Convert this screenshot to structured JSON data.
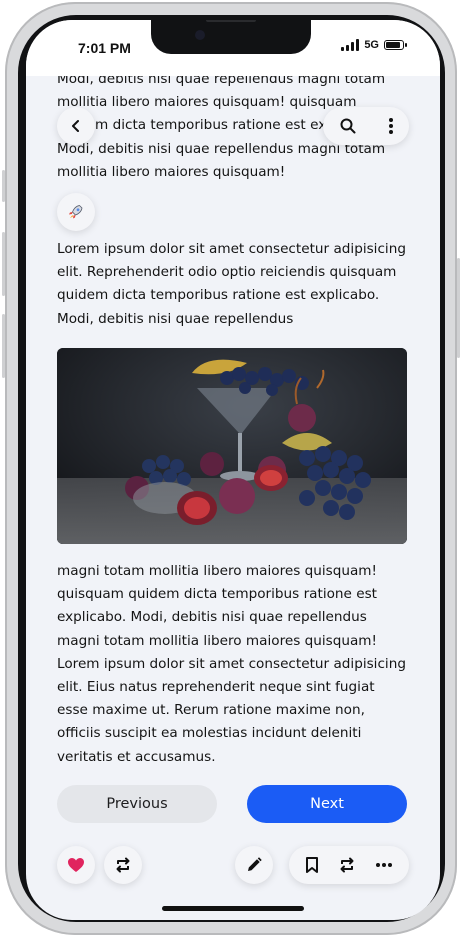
{
  "status_bar": {
    "time": "7:01 PM",
    "network": "5G"
  },
  "article": {
    "para_top": "Modi, debitis nisi quae repellendus magni totam mollitia libero maiores quisquam! quisquam quidem dicta temporibus ratione est explicabo. Modi, debitis nisi quae repellendus magni totam mollitia libero maiores quisquam!",
    "para_middle": "Lorem ipsum dolor sit amet consectetur adipisicing elit. Reprehenderit odio optio reiciendis quisquam quidem dicta temporibus ratione est explicabo. Modi, debitis nisi quae repellendus",
    "para_bottom": "magni totam mollitia libero maiores quisquam! quisquam quidem dicta temporibus ratione est explicabo. Modi, debitis nisi quae repellendus magni totam mollitia libero maiores quisquam! Lorem ipsum dolor sit amet consectetur adipisicing elit. Eius natus reprehenderit neque sint fugiat esse maxime ut. Rerum ratione maxime non, officiis suscipit ea molestias incidunt deleniti veritatis et accusamus."
  },
  "pagination": {
    "previous_label": "Previous",
    "next_label": "Next"
  },
  "icons": {
    "back": "chevron-left-icon",
    "search": "search-icon",
    "more_vertical": "more-vertical-icon",
    "rocket": "rocket-icon",
    "like": "heart-icon",
    "repost": "repost-icon",
    "edit": "pencil-icon",
    "bookmark": "bookmark-icon",
    "more_horizontal": "more-horizontal-icon"
  },
  "colors": {
    "accent": "#1b5cf5",
    "like": "#e0245e",
    "screen_bg": "#f1f3f8"
  }
}
